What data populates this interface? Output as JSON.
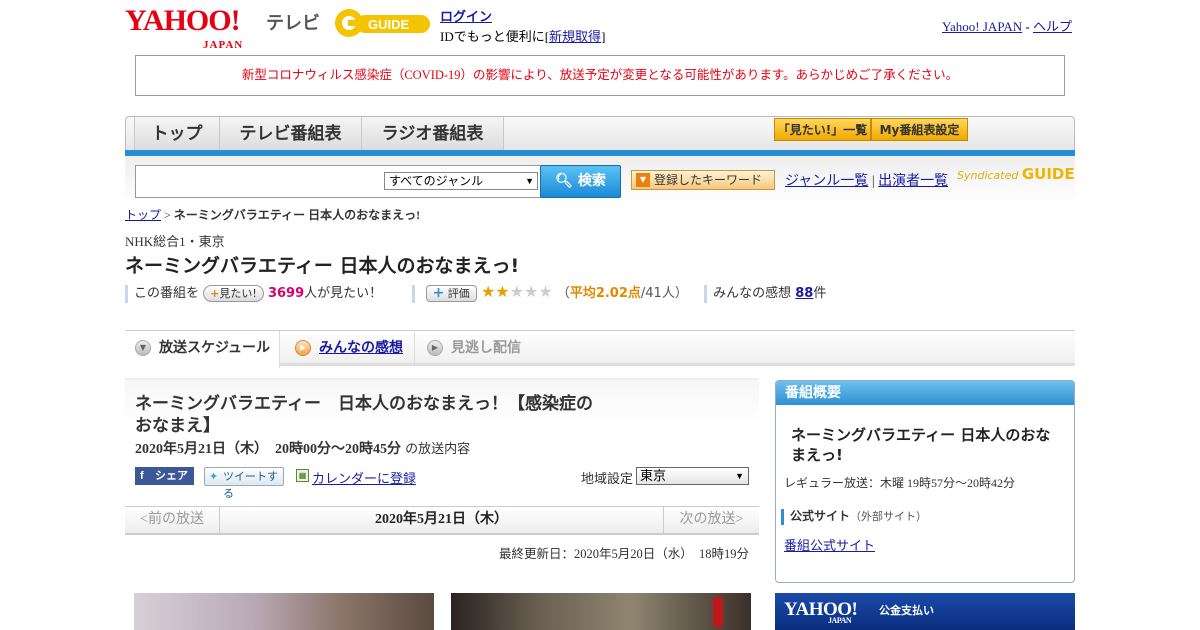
{
  "header": {
    "yahoo_logo": "YAHOO!",
    "yahoo_japan": "JAPAN",
    "tv_label": "テレビ",
    "gguide_logo": "G-GUIDE",
    "login": "ログイン",
    "id_text_pre": "IDでもっと便利に[",
    "signup": "新規取得",
    "id_text_post": "]",
    "yahoo_japan_link": "Yahoo! JAPAN",
    "separator": "-",
    "help_link": "ヘルプ"
  },
  "notice": "新型コロナウィルス感染症（COVID-19）の影響により、放送予定が変更となる可能性があります。あらかじめご了承ください。",
  "nav": {
    "tabs": [
      "トップ",
      "テレビ番組表",
      "ラジオ番組表"
    ],
    "want_list": "「見たい!」一覧",
    "my_schedule": "My番組表設定"
  },
  "search": {
    "query": "",
    "genre": "すべてのジャンル",
    "button": "検索",
    "keyword_button": "登録したキーワード",
    "genre_list": "ジャンル一覧",
    "divider": "|",
    "performer_list": "出演者一覧",
    "syndicated": "Syndicated",
    "syndicated_logo": "GUIDE"
  },
  "breadcrumb": {
    "top": "トップ",
    "sep": ">",
    "current": "ネーミングバラエティー 日本人のおなまえっ!"
  },
  "program": {
    "channel": "NHK総合1・東京",
    "title": "ネーミングバラエティー 日本人のおなまえっ!",
    "want_prefix": "この番組を",
    "want_button": "見たい!",
    "want_count": "3699",
    "want_suffix": "人が見たい！",
    "rate_button": "評価",
    "rating_value": 2,
    "rating_max": 5,
    "avg_open": "（",
    "avg_label": "平均2.02点",
    "avg_count": "/41人）",
    "impression_label": "みんなの感想",
    "impression_count": "88",
    "impression_suffix": "件"
  },
  "tabs": {
    "schedule": "放送スケジュール",
    "impressions": "みんなの感想",
    "streaming": "見逃し配信"
  },
  "episode": {
    "title": "ネーミングバラエティー　日本人のおなまえっ！【感染症のおなまえ】",
    "datetime": "2020年5月21日（木）　20時00分～20時45分",
    "datetime_suffix": "の放送内容",
    "share_fb": "シェア",
    "share_tw": "ツイートする",
    "calendar": "カレンダーに登録",
    "region_label": "地域設定",
    "region_value": "東京",
    "prev": "<前の放送",
    "current_date": "2020年5月21日（木）",
    "next": "次の放送>",
    "updated": "最終更新日：2020年5月20日（水）　18時19分"
  },
  "side": {
    "header": "番組概要",
    "title": "ネーミングバラエティー 日本人のおなまえっ!",
    "regular": "レギュラー放送：木曜 19時57分～20時42分",
    "official_label": "公式サイト",
    "official_note": "（外部サイト）",
    "official_link": "番組公式サイト"
  },
  "ad": {
    "logo": "YAHOO!",
    "logo_sub": "JAPAN",
    "text": "公金支払い"
  },
  "colors": {
    "brand_red": "#e60012",
    "nav_blue": "#2a8bd6",
    "accent_pink": "#d6006f",
    "accent_orange": "#e08a00"
  }
}
